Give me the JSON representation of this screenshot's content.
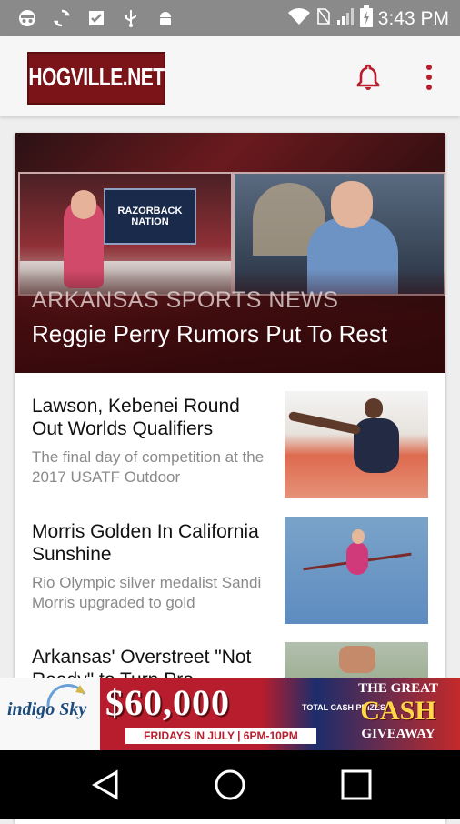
{
  "status_bar": {
    "time": "3:43 PM",
    "icons": [
      "incognito-icon",
      "sync-icon",
      "download-done-icon",
      "usb-icon",
      "android-icon",
      "wifi-icon",
      "no-sim-icon",
      "signal-icon",
      "battery-charging-icon"
    ]
  },
  "app_bar": {
    "logo_text": "HOGVILLE.NET",
    "actions": [
      "bell-icon",
      "more-vert-icon"
    ]
  },
  "hero": {
    "kicker": "ARKANSAS SPORTS NEWS",
    "title": "Reggie Perry Rumors Put To Rest",
    "image_text": "RAZORBACK NATION"
  },
  "articles": [
    {
      "title": "Lawson, Kebenei Round Out Worlds Qualifiers",
      "excerpt": "The final day of competition at the 2017 USATF Outdoor"
    },
    {
      "title": "Morris Golden In California Sunshine",
      "excerpt": "Rio Olympic silver medalist Sandi Morris upgraded to gold"
    },
    {
      "title": "Arkansas' Overstreet \"Not Ready\" to Turn Pro",
      "excerpt": ""
    }
  ],
  "ad": {
    "brand": "indigo Sky",
    "amount": "$60,000",
    "prizes": "TOTAL CASH PRIZES",
    "schedule": "FRIDAYS IN JULY | 6PM-10PM",
    "great": "THE GREAT",
    "cash": "CASH",
    "giveaway": "GIVEAWAY"
  },
  "nav_bar": [
    "back-icon",
    "home-icon",
    "recents-icon"
  ],
  "colors": {
    "brand": "#7a1418",
    "accent": "#b71d2c",
    "status_bar": "#8a8a8a"
  }
}
